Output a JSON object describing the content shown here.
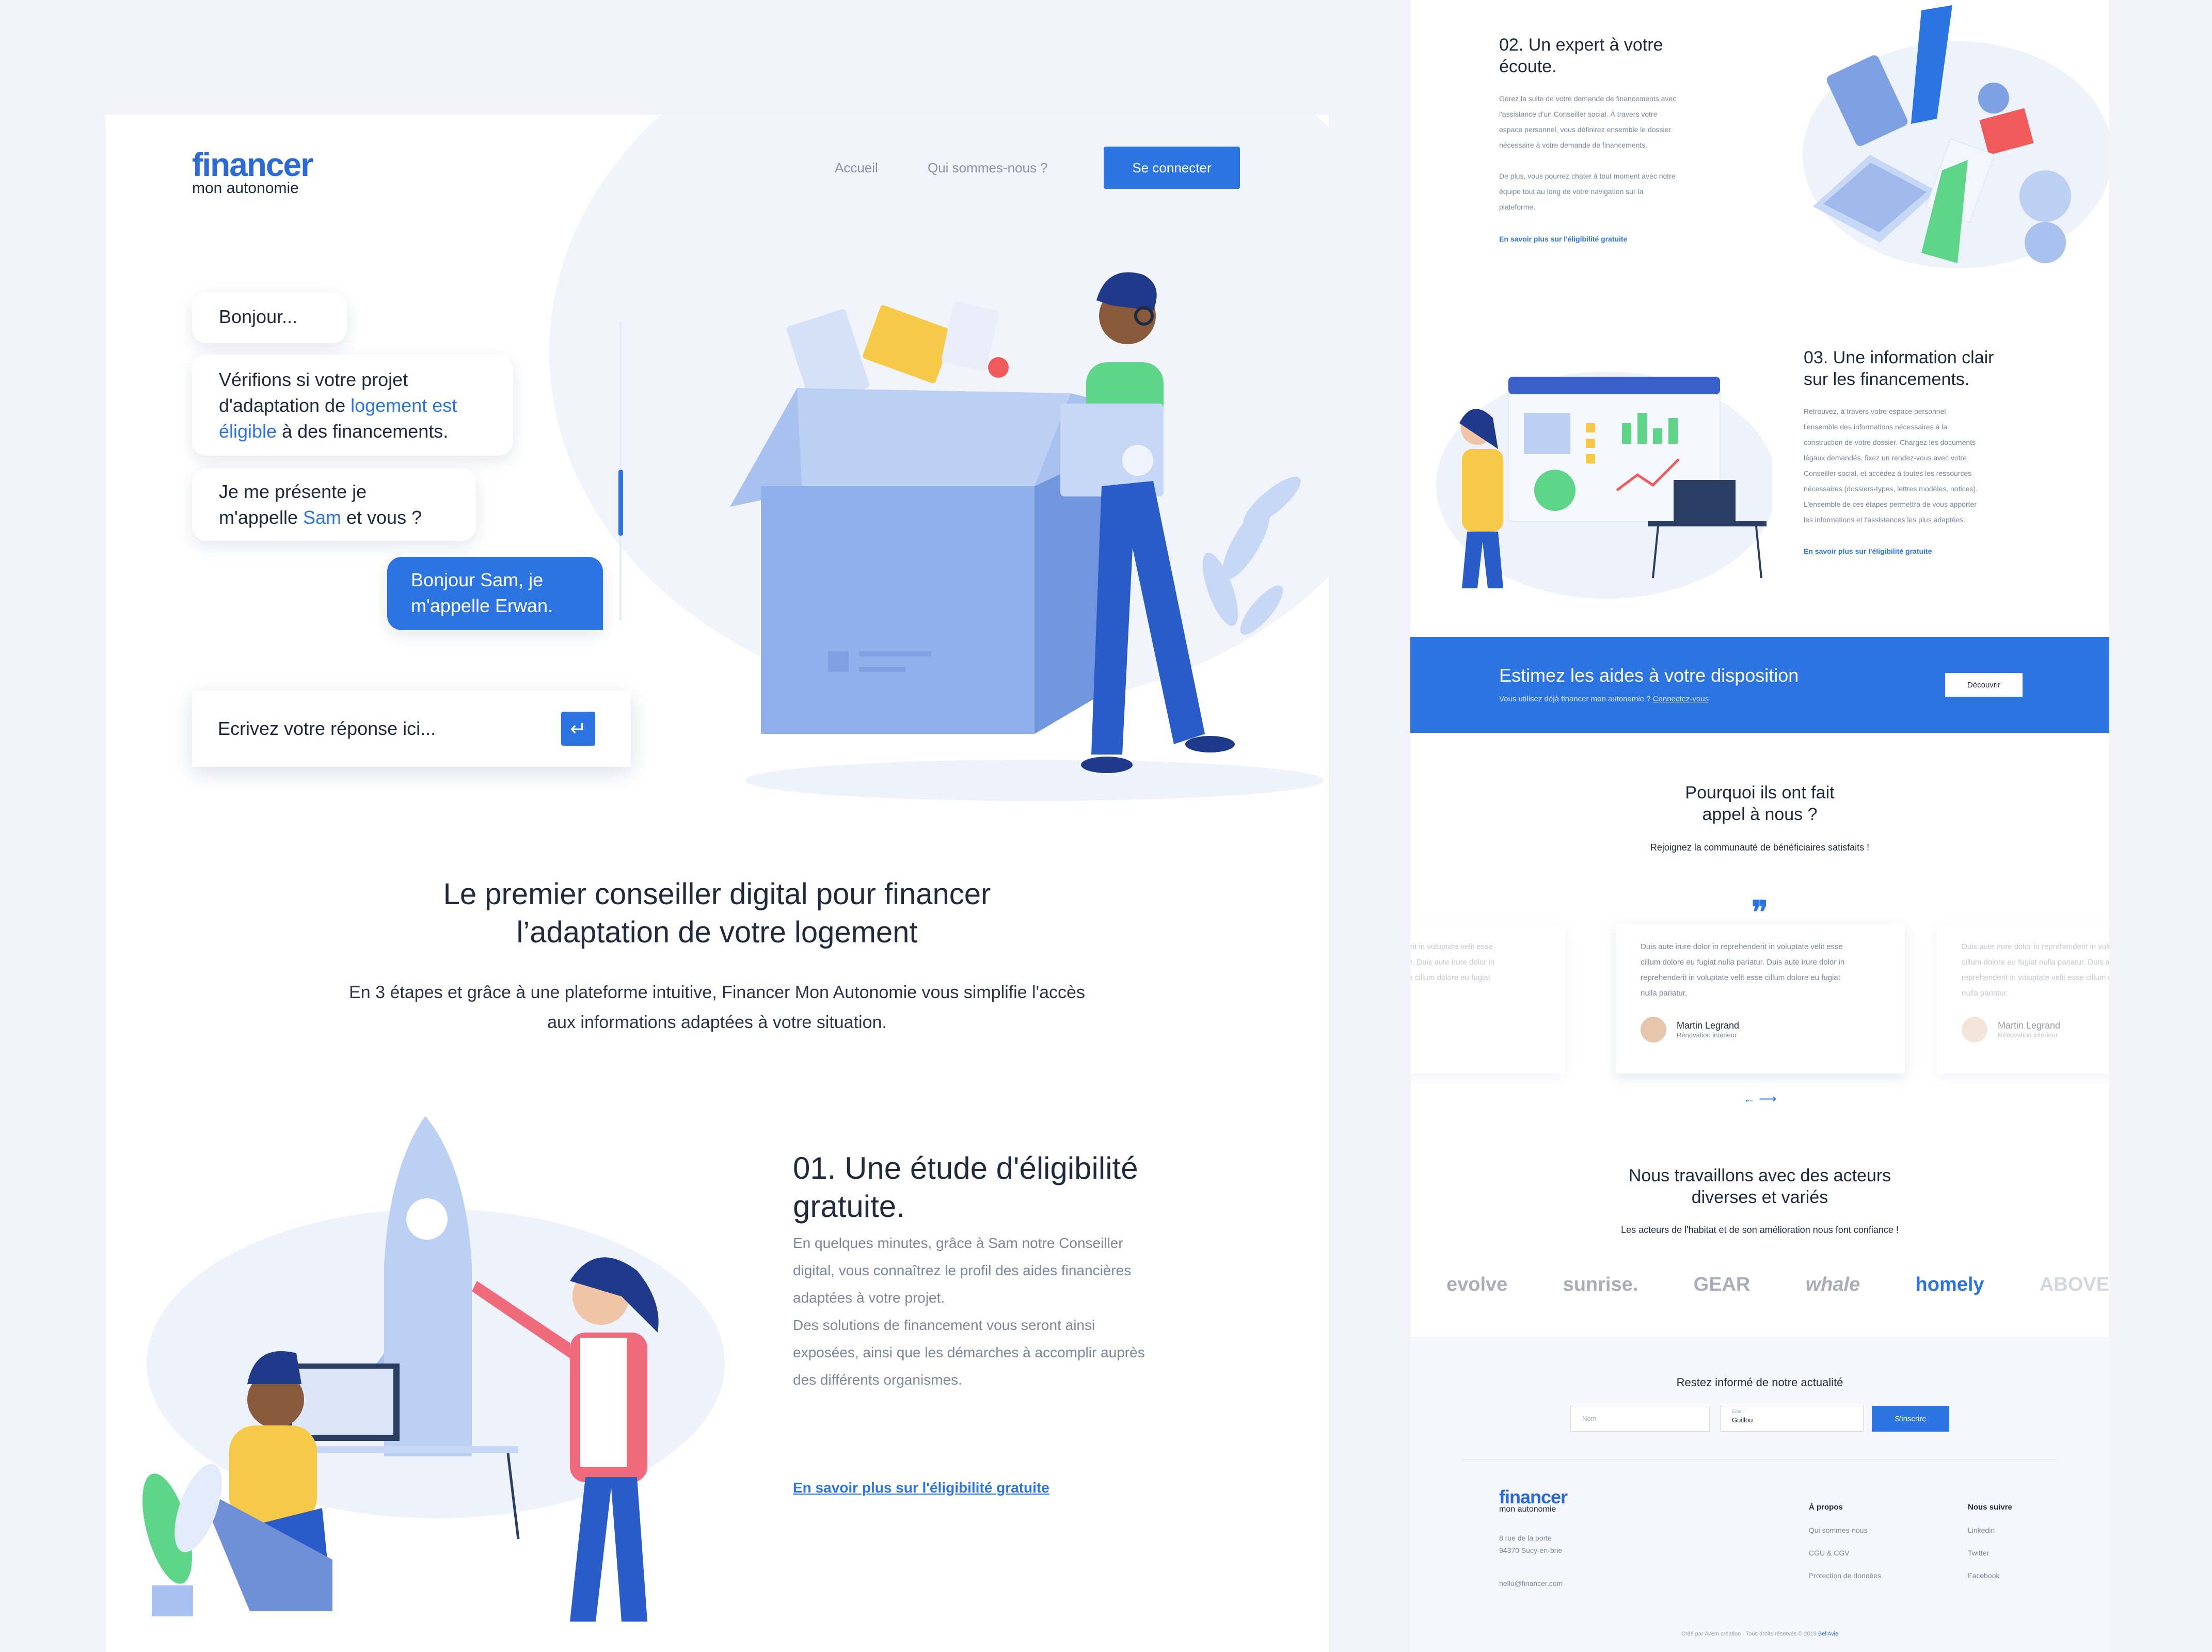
{
  "brand": {
    "logo_main": "financer",
    "logo_sub": "mon autonomie",
    "colors": {
      "primary": "#2b74e2",
      "text": "#1f2a3d",
      "muted": "#7d879a",
      "background": "#f1f3f8"
    }
  },
  "nav": {
    "links": [
      "Accueil",
      "Qui sommes-nous ?"
    ],
    "login_label": "Se connecter"
  },
  "chat": {
    "bubble1": "Bonjour...",
    "bubble2_a": "Vérifions si votre projet",
    "bubble2_b": "d'adaptation de ",
    "bubble2_hl1": "logement est",
    "bubble2_hl2": "éligible",
    "bubble2_c": " à des financements.",
    "bubble3_a": "Je me présente je",
    "bubble3_b": "m'appelle ",
    "bubble3_hl": "Sam",
    "bubble3_c": " et vous ?",
    "bubble4_a": "Bonjour Sam, je",
    "bubble4_b": "m'appelle Erwan.",
    "reply_placeholder": "Ecrivez votre réponse ici...",
    "send_icon": "enter-icon"
  },
  "intro": {
    "title_line1": "Le premier conseiller digital pour financer",
    "title_line2": "l’adaptation de votre logement",
    "text_line1": "En 3 étapes et grâce à une plateforme intuitive, Financer Mon Autonomie vous simplifie l'accès",
    "text_line2": "aux informations adaptées à votre situation."
  },
  "step1": {
    "title_line1": "01. Une étude d'éligibilité",
    "title_line2": "gratuite.",
    "text": [
      "En quelques minutes, grâce à Sam notre Conseiller",
      "digital, vous connaîtrez le profil des aides financières",
      "adaptées à votre projet.",
      "Des solutions de financement vous seront ainsi",
      "exposées, ainsi que les démarches à accomplir auprès",
      "des différents organismes."
    ],
    "link": "En savoir plus sur l'éligibilité gratuite"
  },
  "step2": {
    "title_line1": "02. Un expert à votre",
    "title_line2": "écoute.",
    "text": [
      "Gérez la suite de votre demande de financements avec",
      "l'assistance d'un Conseiller social. À travers votre",
      "espace personnel, vous définirez ensemble le dossier",
      "nécessaire à votre demande de financements.",
      "",
      "De plus, vous pourrez chater à tout moment avec notre",
      "équipe tout au long de votre navigation sur la",
      "plateforme."
    ],
    "link": "En savoir plus sur l'éligibilité gratuite"
  },
  "step3": {
    "title_line1": "03. Une information clair",
    "title_line2": "sur les financements.",
    "text": [
      "Retrouvez, à travers votre espace personnel,",
      "l'ensemble des informations nécessaires à la",
      "construction de votre dossier. Chargez les documents",
      "légaux demandés, fixez un rendez-vous avec votre",
      "Conseiller social, et accédez à toutes les ressources",
      "nécessaires (dossiers-types, lettres modèles, notices).",
      "L'ensemble de ces étapes permettra de vous apporter",
      "les informations et l'assistances les plus adaptées."
    ],
    "link": "En savoir plus sur l'éligibilité gratuite"
  },
  "cta": {
    "title": "Estimez les aides à votre disposition",
    "sub": "Vous utilisez déjà financer mon autonomie ?",
    "sub_link": "Connectez-vous",
    "button": "Découvrir"
  },
  "testimonials": {
    "title_line1": "Pourquoi ils ont fait",
    "title_line2": "appel à nous ?",
    "sub": "Rejoignez la communauté de bénéficiaires satisfaits !",
    "quote_icon": "quote-icon",
    "card_text": [
      "Duis aute irure dolor in reprehenderit in voluptate velit esse",
      "cillum dolore eu fugiat nulla pariatur. Duis aute irure dolor in",
      "reprehenderit in voluptate velit esse cillum dolore eu fugiat",
      "nulla pariatur."
    ],
    "name": "Martin Legrand",
    "role": "Rénovation intérieur",
    "arrows": "←  ⟶"
  },
  "partners": {
    "title_line1": "Nous travaillons avec des acteurs",
    "title_line2": "diverses et variés",
    "sub": "Les acteurs de l'habitat et de son amélioration nous font confiance !",
    "logos": [
      "evolve",
      "sunrise.",
      "GEAR",
      "whale",
      "homely",
      "ABOVE"
    ]
  },
  "newsletter": {
    "title": "Restez informé de notre actualité",
    "name_placeholder": "Nom",
    "email_label": "Email",
    "email_value": "Guillou",
    "button": "S'inscrire"
  },
  "footer": {
    "address_line1": "8 rue de la porte",
    "address_line2": "94370 Sucy-en-brie",
    "email": "hello@financer.com",
    "col1_title": "À propos",
    "col1_items": [
      "Qui sommes-nous",
      "CGU & CGV",
      "Protection de données"
    ],
    "col2_title": "Nous suivre",
    "col2_items": [
      "Linkedin",
      "Twitter",
      "Facebook"
    ],
    "copyright": "Créé par Avem création - Tous droits réservés © 2019",
    "copyright_link": "Bel'Avie"
  }
}
